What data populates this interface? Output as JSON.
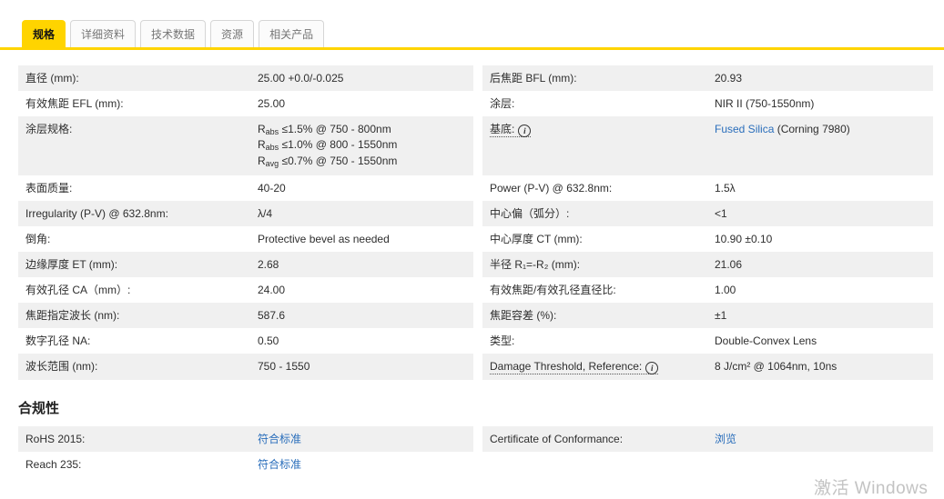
{
  "colors": {
    "accent_yellow": "#FFD400",
    "link_blue": "#2A6EBB",
    "row_stripe": "#F0F0F0"
  },
  "icons": {
    "info": "i"
  },
  "tabs": {
    "items": [
      {
        "label": "规格",
        "active": true
      },
      {
        "label": "详细资料",
        "active": false
      },
      {
        "label": "技术数据",
        "active": false
      },
      {
        "label": "资源",
        "active": false
      },
      {
        "label": "相关产品",
        "active": false
      }
    ]
  },
  "spec_rows": [
    {
      "l1": "直径 (mm):",
      "v1": "25.00 +0.0/-0.025",
      "l2": "后焦距 BFL (mm):",
      "v2": "20.93"
    },
    {
      "l1": "有效焦距 EFL (mm):",
      "v1": "25.00",
      "l2": "涂层:",
      "v2": "NIR II (750-1550nm)"
    },
    {
      "l1": "涂层规格:",
      "v1_lines": [
        {
          "pre": "R",
          "sub": "abs",
          "post": " ≤1.5% @ 750 - 800nm"
        },
        {
          "pre": "R",
          "sub": "abs",
          "post": " ≤1.0% @ 800 - 1550nm"
        },
        {
          "pre": "R",
          "sub": "avg",
          "post": " ≤0.7% @ 750 - 1550nm"
        }
      ],
      "l2": "基底:",
      "v2_link": "Fused Silica",
      "v2_rest": " (Corning 7980)"
    },
    {
      "l1": "表面质量:",
      "v1": "40-20",
      "l2": "Power (P-V) @ 632.8nm:",
      "v2": "1.5λ"
    },
    {
      "l1": "Irregularity (P-V) @ 632.8nm:",
      "v1": "λ/4",
      "l2": "中心偏（弧分）:",
      "v2": "<1"
    },
    {
      "l1": "倒角:",
      "v1": "Protective bevel as needed",
      "l2": "中心厚度 CT (mm):",
      "v2": "10.90 ±0.10"
    },
    {
      "l1": "边缘厚度 ET (mm):",
      "v1": "2.68",
      "l2": "半径 R₁=-R₂ (mm):",
      "v2": "21.06"
    },
    {
      "l1": "有效孔径 CA（mm）:",
      "v1": "24.00",
      "l2": "有效焦距/有效孔径直径比:",
      "v2": "1.00"
    },
    {
      "l1": "焦距指定波长 (nm):",
      "v1": "587.6",
      "l2": "焦距容差 (%):",
      "v2": "±1"
    },
    {
      "l1": "数字孔径 NA:",
      "v1": "0.50",
      "l2": "类型:",
      "v2": "Double-Convex Lens"
    },
    {
      "l1": "波长范围 (nm):",
      "v1": "750 - 1550",
      "l2": "Damage Threshold, Reference:",
      "v2": "8 J/cm² @ 1064nm, 10ns"
    }
  ],
  "compliance": {
    "heading": "合规性",
    "rows": [
      {
        "l1": "RoHS 2015:",
        "v1_link": "符合标准",
        "l2": "Certificate of Conformance:",
        "v2_link": "浏览"
      },
      {
        "l1": "Reach 235:",
        "v1_link": "符合标准"
      }
    ]
  },
  "watermark": {
    "text": "激活 Windows"
  }
}
